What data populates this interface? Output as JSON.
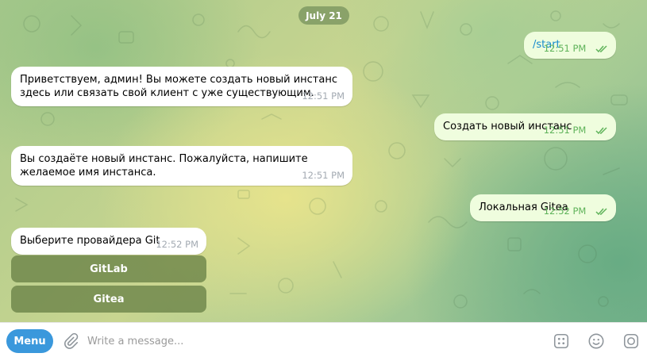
{
  "date_chip": "July 21",
  "messages": [
    {
      "text": "/start",
      "time": "12:51 PM"
    },
    {
      "text": "Приветствуем, админ! Вы можете создать новый инстанс здесь или связать свой клиент с уже существующим.",
      "time": "12:51 PM"
    },
    {
      "text": "Создать новый инстанс",
      "time": "12:51 PM"
    },
    {
      "text": "Вы создаёте новый инстанс. Пожалуйста, напишите желаемое имя инстанса.",
      "time": "12:51 PM"
    },
    {
      "text": "Локальная Gitea",
      "time": "12:52 PM"
    },
    {
      "text": "Выберите провайдера Git",
      "time": "12:52 PM"
    }
  ],
  "keyboard": {
    "buttons": [
      "GitLab",
      "Gitea"
    ]
  },
  "composer": {
    "menu_label": "Menu",
    "placeholder": "Write a message...",
    "icons": [
      "paperclip-icon",
      "commands-icon",
      "emoji-icon",
      "camera-icon"
    ]
  },
  "colors": {
    "outgoing_bubble": "#effdde",
    "incoming_bubble": "#ffffff",
    "outgoing_time": "#5fb35a",
    "link_blue": "#168acd",
    "menu_button": "#3a98dc",
    "keyboard_button": "#69824680"
  }
}
